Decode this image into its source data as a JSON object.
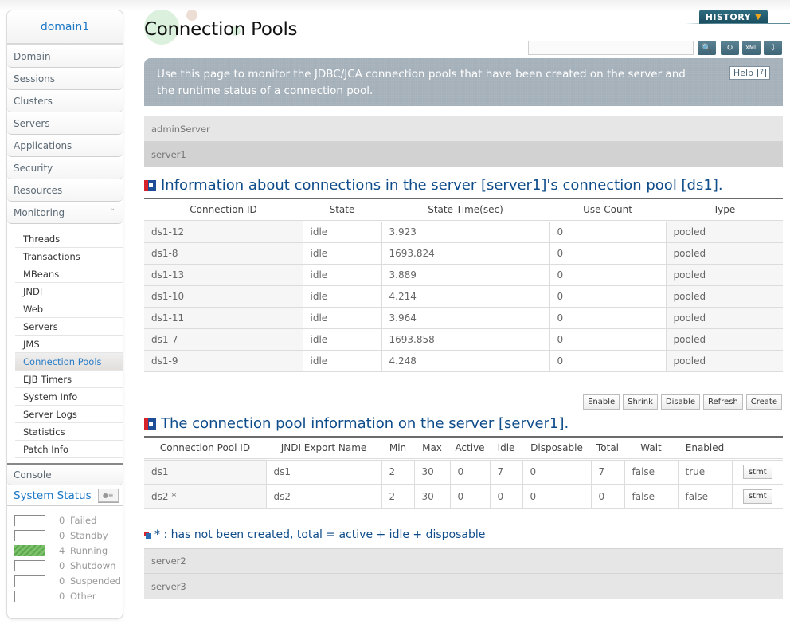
{
  "sidebar": {
    "domain": "domain1",
    "nav": [
      {
        "label": "Domain"
      },
      {
        "label": "Sessions"
      },
      {
        "label": "Clusters"
      },
      {
        "label": "Servers"
      },
      {
        "label": "Applications"
      },
      {
        "label": "Security"
      },
      {
        "label": "Resources"
      },
      {
        "label": "Monitoring",
        "expanded": true
      }
    ],
    "monitoring_items": [
      {
        "label": "Threads"
      },
      {
        "label": "Transactions"
      },
      {
        "label": "MBeans"
      },
      {
        "label": "JNDI"
      },
      {
        "label": "Web"
      },
      {
        "label": "Servers"
      },
      {
        "label": "JMS"
      },
      {
        "label": "Connection Pools",
        "active": true
      },
      {
        "label": "EJB Timers"
      },
      {
        "label": "System Info"
      },
      {
        "label": "Server Logs"
      },
      {
        "label": "Statistics"
      },
      {
        "label": "Patch Info"
      }
    ],
    "console": "Console",
    "system_status": {
      "title": "System Status",
      "items": [
        {
          "count": "0",
          "label": "Failed"
        },
        {
          "count": "0",
          "label": "Standby"
        },
        {
          "count": "4",
          "label": "Running"
        },
        {
          "count": "0",
          "label": "Shutdown"
        },
        {
          "count": "0",
          "label": "Suspended"
        },
        {
          "count": "0",
          "label": "Other"
        }
      ]
    }
  },
  "header": {
    "title": "Connection Pools",
    "history": "HISTORY",
    "search": {
      "value": "",
      "placeholder": ""
    },
    "description": "Use this page to monitor the JDBC/JCA connection pools that have been created on the server and the runtime status of a connection pool.",
    "help": "Help",
    "help_glyph": "?"
  },
  "servers": {
    "admin": "adminServer",
    "server1": "server1",
    "server2": "server2",
    "server3": "server3"
  },
  "connections": {
    "title": "Information about connections in the server [server1]'s connection pool [ds1].",
    "columns": [
      "Connection ID",
      "State",
      "State Time(sec)",
      "Use Count",
      "Type"
    ],
    "rows": [
      [
        "ds1-12",
        "idle",
        "3.923",
        "0",
        "pooled"
      ],
      [
        "ds1-8",
        "idle",
        "1693.824",
        "0",
        "pooled"
      ],
      [
        "ds1-13",
        "idle",
        "3.889",
        "0",
        "pooled"
      ],
      [
        "ds1-10",
        "idle",
        "4.214",
        "0",
        "pooled"
      ],
      [
        "ds1-11",
        "idle",
        "3.964",
        "0",
        "pooled"
      ],
      [
        "ds1-7",
        "idle",
        "1693.858",
        "0",
        "pooled"
      ],
      [
        "ds1-9",
        "idle",
        "4.248",
        "0",
        "pooled"
      ]
    ]
  },
  "actions": [
    "Enable",
    "Shrink",
    "Disable",
    "Refresh",
    "Create"
  ],
  "pools": {
    "title": "The connection pool information on the server [server1].",
    "columns": [
      "Connection Pool ID",
      "JNDI Export Name",
      "Min",
      "Max",
      "Active",
      "Idle",
      "Disposable",
      "Total",
      "Wait",
      "Enabled",
      ""
    ],
    "rows": [
      [
        "ds1",
        "ds1",
        "2",
        "30",
        "0",
        "7",
        "0",
        "7",
        "false",
        "true"
      ],
      [
        "ds2 *",
        "ds2",
        "2",
        "30",
        "0",
        "0",
        "0",
        "0",
        "false",
        "false"
      ]
    ],
    "stmt_label": "stmt"
  },
  "note": "* : has not been created, total = active + idle + disposable"
}
